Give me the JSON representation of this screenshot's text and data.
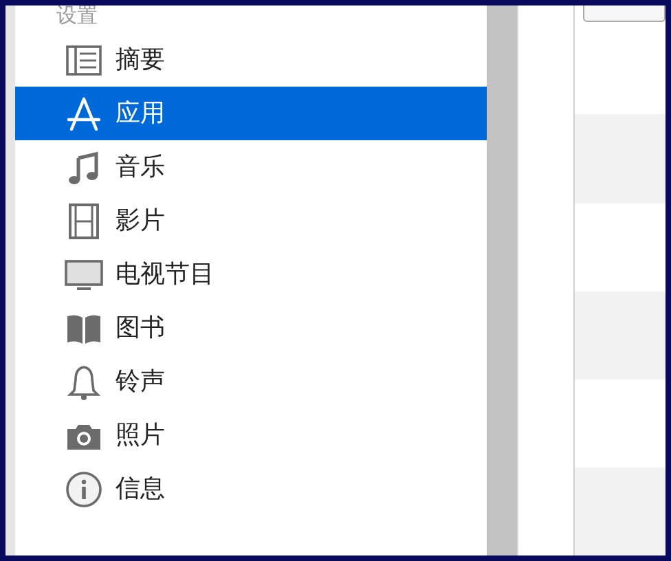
{
  "sidebar": {
    "section_title": "设置",
    "items": [
      {
        "label": "摘要",
        "kind": "summary",
        "selected": false
      },
      {
        "label": "应用",
        "kind": "apps",
        "selected": true
      },
      {
        "label": "音乐",
        "kind": "music",
        "selected": false
      },
      {
        "label": "影片",
        "kind": "movies",
        "selected": false
      },
      {
        "label": "电视节目",
        "kind": "tv",
        "selected": false
      },
      {
        "label": "图书",
        "kind": "books",
        "selected": false
      },
      {
        "label": "铃声",
        "kind": "tones",
        "selected": false
      },
      {
        "label": "照片",
        "kind": "photos",
        "selected": false
      },
      {
        "label": "信息",
        "kind": "info",
        "selected": false
      }
    ]
  }
}
